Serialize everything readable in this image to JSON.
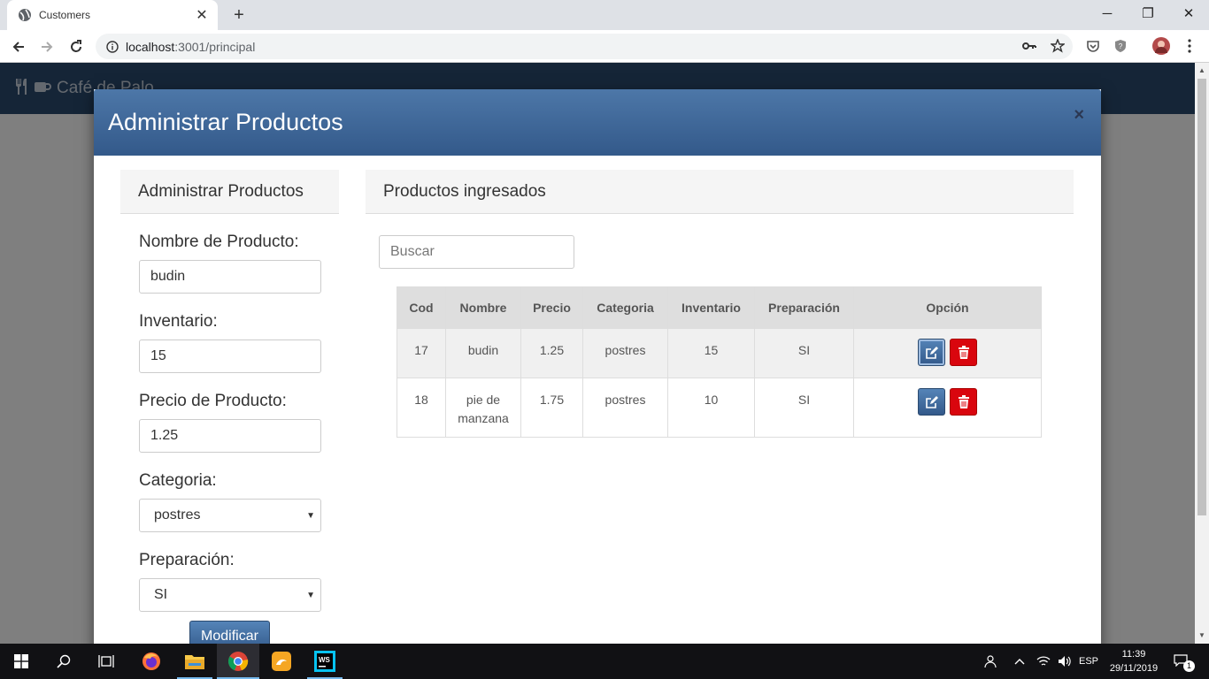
{
  "browser": {
    "tab_title": "Customers",
    "url_host": "localhost",
    "url_path": ":3001/principal"
  },
  "app": {
    "brand": "Café de Palo"
  },
  "modal": {
    "title": "Administrar Productos",
    "close": "×",
    "left_panel": {
      "heading": "Administrar Productos",
      "fields": {
        "nombre_label": "Nombre de Producto:",
        "nombre_value": "budin",
        "inventario_label": "Inventario:",
        "inventario_value": "15",
        "precio_label": "Precio de Producto:",
        "precio_value": "1.25",
        "categoria_label": "Categoria:",
        "categoria_value": "postres",
        "preparacion_label": "Preparación:",
        "preparacion_value": "SI"
      },
      "submit_label": "Modificar"
    },
    "right_panel": {
      "heading": "Productos ingresados",
      "search_placeholder": "Buscar",
      "table": {
        "headers": [
          "Cod",
          "Nombre",
          "Precio",
          "Categoria",
          "Inventario",
          "Preparación",
          "Opción"
        ],
        "rows": [
          [
            "17",
            "budin",
            "1.25",
            "postres",
            "15",
            "SI"
          ],
          [
            "18",
            "pie de manzana",
            "1.75",
            "postres",
            "10",
            "SI"
          ]
        ]
      }
    }
  },
  "taskbar": {
    "lang": "ESP",
    "time": "11:39",
    "date": "29/11/2019",
    "notif_count": "1"
  },
  "colors": {
    "modal_header": "#3d6797",
    "delete_btn": "#d9060e",
    "navbar": "#2b4a6f"
  }
}
